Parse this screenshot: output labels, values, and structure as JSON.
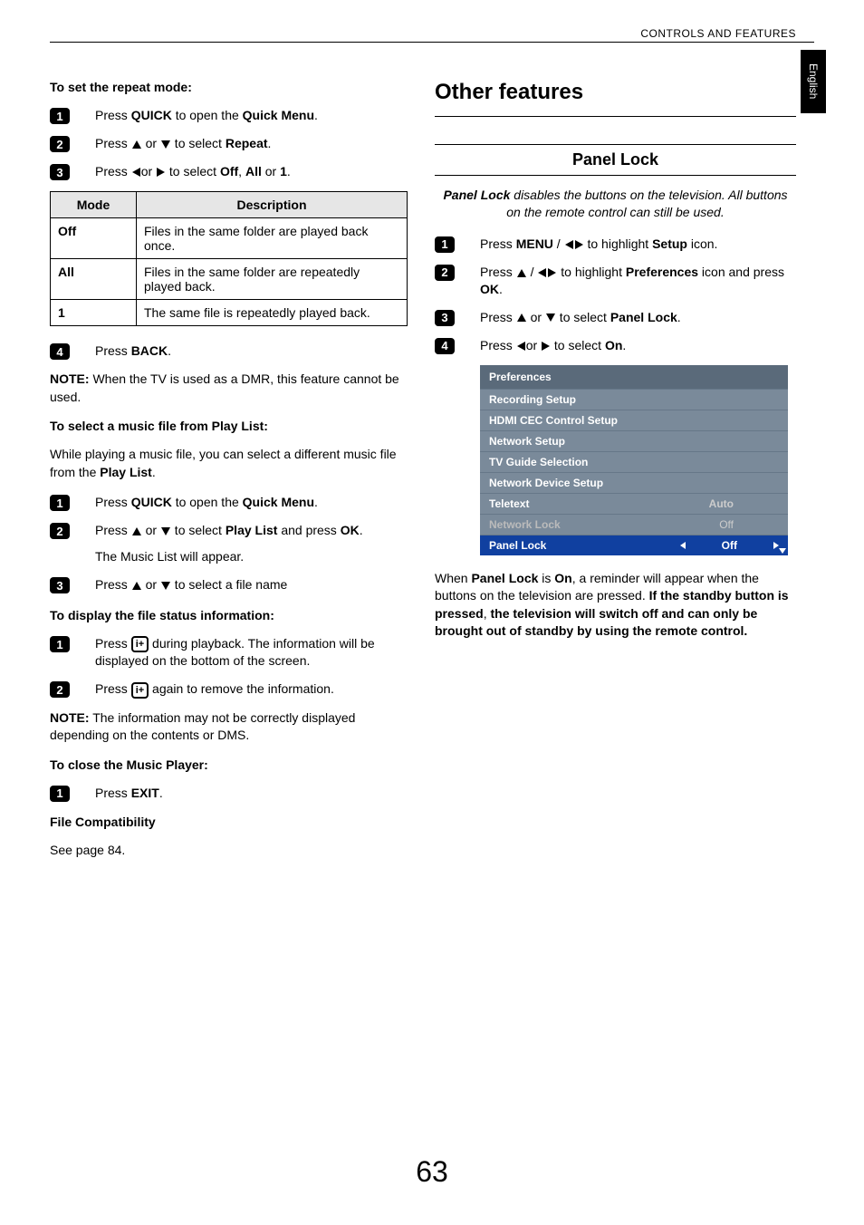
{
  "header": "CONTROLS AND FEATURES",
  "language_tab": "English",
  "page_number": "63",
  "left": {
    "repeat_heading": "To set the repeat mode:",
    "repeat_steps": {
      "s1": {
        "pre": "Press ",
        "b1": "QUICK",
        "mid": " to open the ",
        "b2": "Quick Menu",
        "post": "."
      },
      "s2": {
        "pre": "Press ",
        "mid": " or ",
        "post": " to select ",
        "b1": "Repeat",
        "end": "."
      },
      "s3": {
        "pre": "Press ",
        "mid": "or ",
        "post": " to select ",
        "b1": "Off",
        "c1": ", ",
        "b2": "All",
        "c2": " or ",
        "b3": "1",
        "end": "."
      }
    },
    "table": {
      "h1": "Mode",
      "h2": "Description",
      "r1c1": "Off",
      "r1c2": "Files in the same folder are played back once.",
      "r2c1": "All",
      "r2c2": "Files in the same folder are repeatedly played back.",
      "r3c1": "1",
      "r3c2": "The same file is repeatedly played back."
    },
    "step4": {
      "pre": "Press ",
      "b1": "BACK",
      "post": "."
    },
    "note1_label": "NOTE:",
    "note1_text": " When the TV is used as a DMR, this feature cannot be used.",
    "playlist_heading": "To select a music file from Play List:",
    "playlist_intro_pre": "While playing a music file, you can select a different music file from the ",
    "playlist_intro_bold": "Play List",
    "playlist_intro_post": ".",
    "playlist_steps": {
      "s1": {
        "pre": "Press ",
        "b1": "QUICK",
        "mid": " to open the ",
        "b2": "Quick Menu",
        "post": "."
      },
      "s2": {
        "pre": "Press ",
        "mid": " or ",
        "post": " to select ",
        "b1": "Play List",
        "c1": " and press ",
        "b2": "OK",
        "end": "."
      },
      "s2_sub": "The Music List will appear.",
      "s3": {
        "pre": "Press ",
        "mid": " or ",
        "post": " to select a file name"
      }
    },
    "status_heading": "To display the file status information:",
    "status_steps": {
      "s1_pre": "Press ",
      "s1_post": " during playback. The information will be displayed on the bottom of the screen.",
      "s2_pre": "Press ",
      "s2_post": " again to remove the information."
    },
    "note2_label": "NOTE:",
    "note2_text": " The information may not be correctly displayed depending on the contents or DMS.",
    "close_heading": "To close the Music Player:",
    "close_step": {
      "pre": "Press ",
      "b1": "EXIT",
      "post": "."
    },
    "compat_heading": "File Compatibility",
    "compat_text": "See page 84."
  },
  "right": {
    "title": "Other features",
    "panel_lock_title": "Panel Lock",
    "intro_b": "Panel Lock",
    "intro_rest": " disables the buttons on the television. All buttons on the remote control can still be used.",
    "steps": {
      "s1": {
        "pre": "Press ",
        "b1": "MENU",
        "mid": " / ",
        "post": " to highlight ",
        "b2": "Setup",
        "end": " icon."
      },
      "s2": {
        "pre": "Press ",
        "mid": " / ",
        "post": " to highlight ",
        "b1": "Preferences",
        "c1": " icon and press ",
        "b2": "OK",
        "end": "."
      },
      "s3": {
        "pre": "Press ",
        "mid": " or ",
        "post": " to select ",
        "b1": "Panel Lock",
        "end": "."
      },
      "s4": {
        "pre": "Press ",
        "mid": "or  ",
        "post": " to select ",
        "b1": "On",
        "end": "."
      }
    },
    "menu": {
      "header": "Preferences",
      "rows": [
        {
          "label": "Recording Setup",
          "value": ""
        },
        {
          "label": "HDMI CEC Control Setup",
          "value": ""
        },
        {
          "label": "Network Setup",
          "value": ""
        },
        {
          "label": "TV Guide Selection",
          "value": ""
        },
        {
          "label": "Network Device Setup",
          "value": ""
        },
        {
          "label": "Teletext",
          "value": "Auto"
        },
        {
          "label": "Network Lock",
          "value": "Off"
        },
        {
          "label": "Panel Lock",
          "value": "Off"
        }
      ]
    },
    "outro_pre": "When ",
    "outro_b1": "Panel Lock",
    "outro_mid1": " is ",
    "outro_b2": "On",
    "outro_mid2": ", a reminder will appear when the buttons on the television are pressed. ",
    "outro_b3": "If the standby button is pressed",
    "outro_mid3": ", ",
    "outro_b4": "the television will switch off and can only be brought out of standby by using the remote control."
  }
}
